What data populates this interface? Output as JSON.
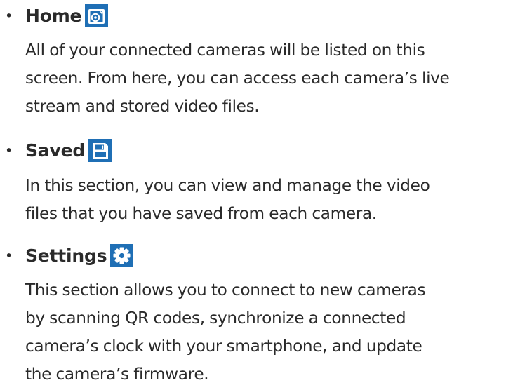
{
  "sections": [
    {
      "title": "Home",
      "icon": "home-camera-icon",
      "lines": [
        "All of your connected cameras will be listed on this",
        "screen. From here, you can access each camera’s live",
        "stream and stored video files."
      ]
    },
    {
      "title": "Saved",
      "icon": "save-disk-icon",
      "lines": [
        "In this section, you can view and manage the video",
        "files that you have saved from each camera."
      ]
    },
    {
      "title": "Settings",
      "icon": "gear-icon",
      "lines": [
        "This section allows you to connect to new cameras",
        "by scanning QR codes, synchronize a connected",
        "camera’s clock with your smartphone, and update",
        "the camera’s firmware."
      ]
    }
  ],
  "bullet": "•",
  "colors": {
    "icon_background": "#1f6fb5",
    "text": "#2a2a2a"
  }
}
